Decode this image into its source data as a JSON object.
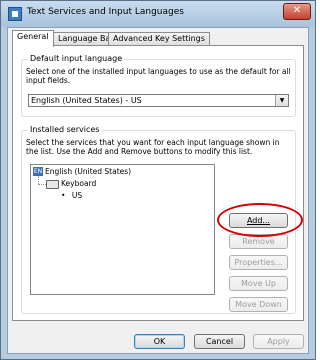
{
  "window": {
    "title": "Text Services and Input Languages",
    "close_glyph": "✕"
  },
  "tabs": [
    {
      "label": "General",
      "active": true
    },
    {
      "label": "Language Bar",
      "active": false
    },
    {
      "label": "Advanced Key Settings",
      "active": false
    }
  ],
  "default_language": {
    "legend": "Default input language",
    "description": "Select one of the installed input languages to use as the default for all input fields.",
    "selected": "English (United States) - US",
    "arrow": "▼"
  },
  "installed_services": {
    "legend": "Installed services",
    "description": "Select the services that you want for each input language shown in the list. Use the Add and Remove buttons to modify this list.",
    "tree": {
      "language_badge": "EN",
      "language": "English (United States)",
      "category": "Keyboard",
      "bullet": "•",
      "item": "US"
    },
    "buttons": {
      "add": "Add...",
      "remove": "Remove",
      "properties": "Properties...",
      "move_up": "Move Up",
      "move_down": "Move Down"
    }
  },
  "footer": {
    "ok": "OK",
    "cancel": "Cancel",
    "apply": "Apply"
  },
  "annotation_color": "#d90000"
}
